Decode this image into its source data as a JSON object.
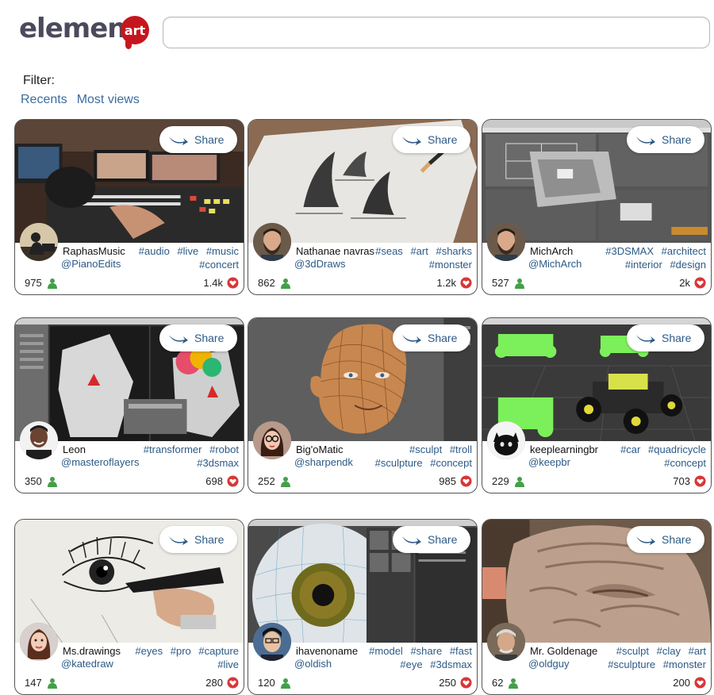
{
  "brand": {
    "wordmark": "element",
    "badge": "art",
    "accent": "#c6161d"
  },
  "search": {
    "value": "",
    "placeholder": ""
  },
  "filter": {
    "label": "Filter:",
    "options": [
      "Recents",
      "Most views"
    ]
  },
  "share_label": "Share",
  "colors": {
    "link": "#2c5a86",
    "like_icon": "#43a047",
    "heart_icon": "#d93636"
  },
  "cards": [
    {
      "name": "RaphasMusic",
      "handle": "@PianoEdits",
      "tags": [
        "#audio",
        "#live",
        "#music",
        "#concert"
      ],
      "likes": "975",
      "hearts": "1.4k",
      "thumb": "audio-mixing-console",
      "avatar": "silhouette-pianist"
    },
    {
      "name": "Nathanae navras",
      "handle": "@3dDraws",
      "tags": [
        "#seas",
        "#art",
        "#sharks",
        "#monster"
      ],
      "likes": "862",
      "hearts": "1.2k",
      "thumb": "3d-pencil-shark-drawing",
      "avatar": "bearded-man"
    },
    {
      "name": "MichArch",
      "handle": "@MichArch",
      "tags": [
        "#3DSMAX",
        "#architect",
        "#interior",
        "#design"
      ],
      "likes": "527",
      "hearts": "2k",
      "thumb": "3dsmax-architecture",
      "avatar": "bearded-man"
    },
    {
      "name": "Leon",
      "handle": "@masteroflayers",
      "tags": [
        "#transformer",
        "#robot",
        "#3dsmax"
      ],
      "likes": "350",
      "hearts": "698",
      "thumb": "robot-model",
      "avatar": "smiling-man"
    },
    {
      "name": "Big'oMatic",
      "handle": "@sharpendk",
      "tags": [
        "#sculpt",
        "#troll",
        "#sculpture",
        "#concept"
      ],
      "likes": "252",
      "hearts": "985",
      "thumb": "wireframe-head",
      "avatar": "woman-glasses"
    },
    {
      "name": "keeplearningbr",
      "handle": "@keepbr",
      "tags": [
        "#car",
        "#quadricycle",
        "#concept"
      ],
      "likes": "229",
      "hearts": "703",
      "thumb": "buggy-model",
      "avatar": "black-cat"
    },
    {
      "name": "Ms.drawings",
      "handle": "@katedraw",
      "tags": [
        "#eyes",
        "#pro",
        "#capture",
        "#live"
      ],
      "likes": "147",
      "hearts": "280",
      "thumb": "eye-sketch",
      "avatar": "woman"
    },
    {
      "name": "ihavenoname",
      "handle": "@oldish",
      "tags": [
        "#model",
        "#share",
        "#fast",
        "#eye",
        "#3dsmax"
      ],
      "likes": "120",
      "hearts": "250",
      "thumb": "eyeball-render",
      "avatar": "young-man"
    },
    {
      "name": "Mr. Goldenage",
      "handle": "@oldguy",
      "tags": [
        "#sculpt",
        "#clay",
        "#art",
        "#sculpture",
        "#monster"
      ],
      "likes": "62",
      "hearts": "200",
      "thumb": "clay-sculpture",
      "avatar": "older-man"
    }
  ]
}
